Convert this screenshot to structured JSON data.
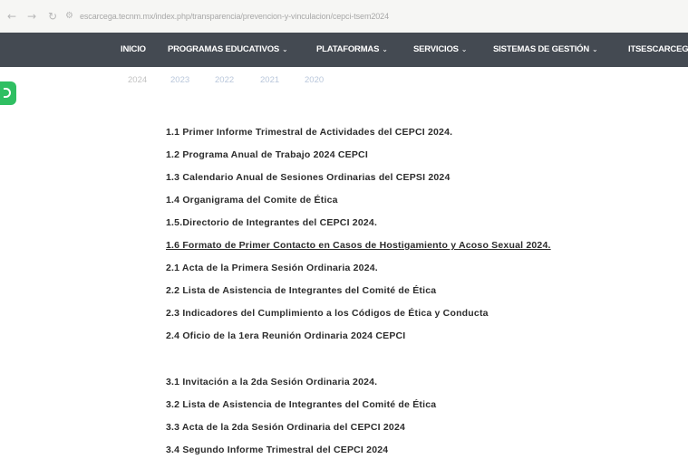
{
  "browser": {
    "url": "escarcega.tecnm.mx/index.php/transparencia/prevencion-y-vinculacion/cepci-tsem2024"
  },
  "nav": {
    "items": [
      {
        "label": "INICIO",
        "caret": ""
      },
      {
        "label": "PROGRAMAS EDUCATIVOS",
        "caret": "⌄"
      },
      {
        "label": "PLATAFORMAS",
        "caret": "⌄"
      },
      {
        "label": "SERVICIOS",
        "caret": "⌄"
      },
      {
        "label": "SISTEMAS DE GESTIÓN",
        "caret": "⌄"
      },
      {
        "label": "ITSESCARCEGA",
        "caret": ""
      }
    ]
  },
  "years": {
    "items": [
      "2024",
      "2023",
      "2022",
      "2021",
      "2020"
    ],
    "active": "2024"
  },
  "documents": {
    "items": [
      "1.1 Primer Informe Trimestral de Actividades del CEPCI 2024.",
      "1.2 Programa Anual de Trabajo 2024 CEPCI",
      "1.3 Calendario Anual de Sesiones Ordinarias del CEPSI 2024",
      "1.4 Organigrama del Comite de Ética",
      "1.5.Directorio de Integrantes del CEPCI 2024.",
      "1.6 Formato de Primer Contacto en Casos de Hostigamiento y Acoso Sexual 2024.",
      "2.1 Acta de la Primera Sesión Ordinaria 2024.",
      "2.2 Lista de Asistencia de Integrantes del Comité de Ética",
      "2.3 Indicadores del Cumplimiento a los Códigos de Ética y Conducta",
      "2.4 Oficio de la 1era Reunión Ordinaria 2024 CEPCI",
      "3.1 Invitación a la 2da Sesión Ordinaria 2024.",
      "3.2 Lista de Asistencia de Integrantes del Comité de Ética",
      "3.3 Acta de la 2da Sesión Ordinaria del CEPCI 2024",
      "3.4 Segundo Informe Trimestral del CEPCI 2024"
    ]
  }
}
